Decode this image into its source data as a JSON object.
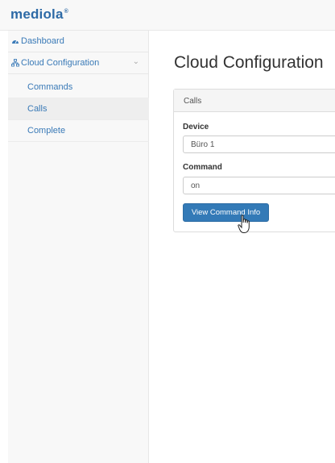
{
  "brand": {
    "name": "mediola",
    "mark": "®"
  },
  "sidebar": {
    "items": [
      {
        "label": "Dashboard",
        "icon": "dashboard-icon"
      },
      {
        "label": "Cloud Configuration",
        "icon": "sitemap-icon",
        "expanded": true
      }
    ],
    "subitems": [
      {
        "label": "Commands"
      },
      {
        "label": "Calls",
        "active": true
      },
      {
        "label": "Complete"
      }
    ]
  },
  "main": {
    "title": "Cloud Configuration",
    "panel": {
      "heading": "Calls",
      "device_label": "Device",
      "device_value": "Büro 1",
      "command_label": "Command",
      "command_value": "on",
      "button_label": "View Command Info"
    }
  },
  "colors": {
    "accent": "#337ab7",
    "link": "#3a7ab7",
    "sidebar_bg": "#f8f8f8"
  }
}
